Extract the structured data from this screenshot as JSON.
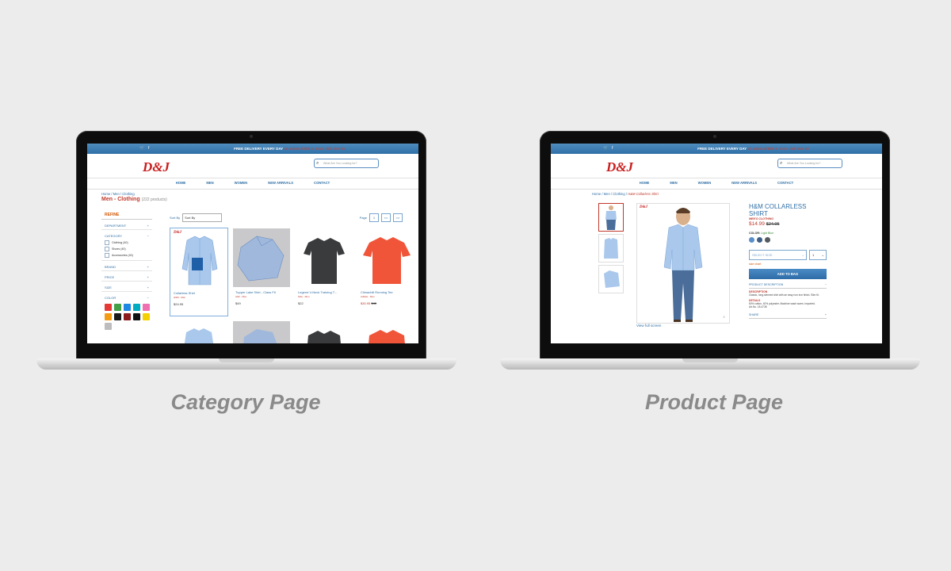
{
  "site": {
    "logo": "D&J",
    "promo_bold": "FREE DELIVERY EVERY DAY",
    "promo_rest": "on orders of $50 or more, click here for",
    "search_placeholder": "What Are You Looking for?",
    "nav": [
      "HOME",
      "MEN",
      "WOMEN",
      "NEW ARRIVALS",
      "CONTACT"
    ]
  },
  "category_page": {
    "caption": "Category Page",
    "breadcrumb": "Home / Men / Clothing",
    "title": "Men - Clothing",
    "count": "(222 products)",
    "refine_label": "REFINE",
    "facets": {
      "department": "DEPARTMENT",
      "category": "CATEGORY",
      "brand": "BRAND",
      "price": "PRICE",
      "size": "SIZE",
      "color": "COLOR"
    },
    "category_options": [
      "Clothing (40)",
      "Shoes (40)",
      "Accessories (40)"
    ],
    "swatches": [
      "#e53935",
      "#43a047",
      "#1e88e5",
      "#00acc1",
      "#ef6fb0",
      "#f39c12",
      "#1a1a1a",
      "#8e1b1b",
      "#111111",
      "#f5d000",
      "#bdbdbd"
    ],
    "sort_label": "Sort By",
    "sort_value": "Sort By",
    "page_label": "Page",
    "page_value": "1",
    "prev_label": "<<",
    "next_label": ">>",
    "products": [
      {
        "name": "Collarless Shirt",
        "brand": "H&M - Men",
        "price": "$24.95",
        "old": ""
      },
      {
        "name": "Tupper Lake Shirt - Class Fit",
        "brand": "A&F - Men",
        "price": "$49",
        "old": ""
      },
      {
        "name": "Legend V-Neck Training T...",
        "brand": "Nike - Men",
        "price": "$22",
        "old": ""
      },
      {
        "name": "Climachill Running Tee",
        "brand": "Adidas - Men",
        "price": "$30.95",
        "old": "$45"
      }
    ]
  },
  "product_page": {
    "caption": "Product Page",
    "breadcrumb": "Home / Men / Clothing / ",
    "breadcrumb_current": "H&M Collarless Shirt",
    "title": "H&M COLLARLESS SHIRT",
    "brand": "MEN'S CLOTHING",
    "price": "$14.99",
    "old_price": "$24.95",
    "color_label": "COLOR:",
    "color_value": "Light Blue",
    "colors": [
      "#5a8fc9",
      "#3f5f86",
      "#555a60"
    ],
    "size_placeholder": "SELECT SIZE",
    "qty": "1",
    "size_chart": "size chart",
    "add_to_bag": "ADD TO BAG",
    "desc_header": "PRODUCT DESCRIPTION",
    "desc_label": "DESCRIPTION",
    "desc_text": "Classic, long-sleeved shirt with an easy non iron finish. Slim fit.",
    "details_label": "DETAILS",
    "details_text": "60% cotton, 40% polyester. Machine wash warm. Imported.",
    "art_no": "Art.No. 18-4738",
    "share_label": "SHARE",
    "view_full": "View full screen"
  }
}
